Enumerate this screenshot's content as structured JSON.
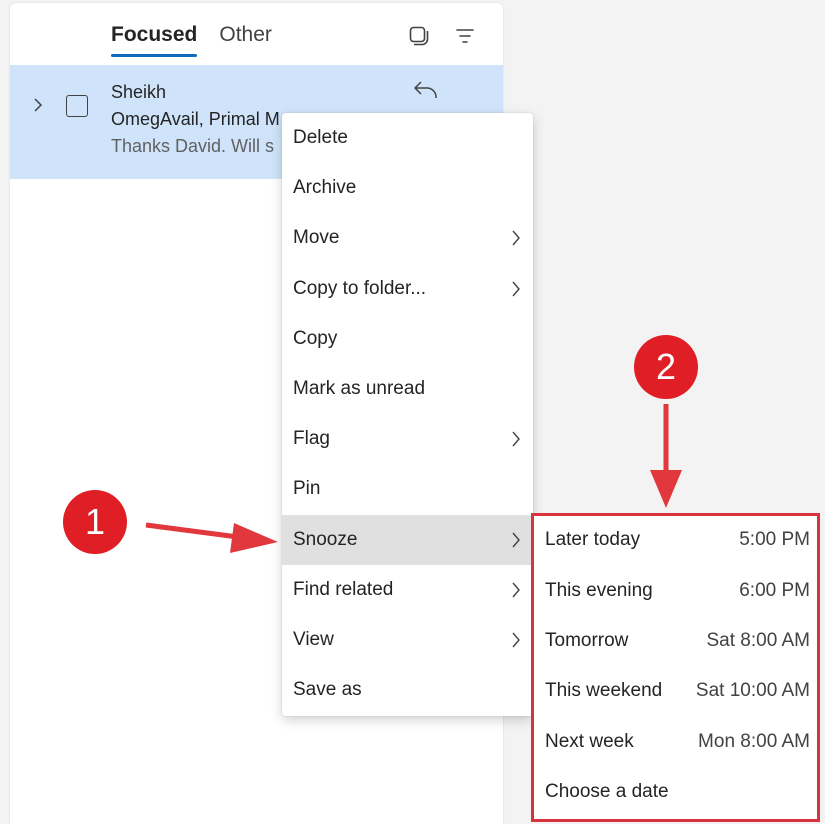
{
  "pivot": {
    "tabs": [
      {
        "label": "Focused",
        "active": true
      },
      {
        "label": "Other",
        "active": false
      }
    ]
  },
  "icons": {
    "select_mode": "select-mode-icon",
    "filter": "filter-icon",
    "expand": "chevron-right-icon",
    "reply": "reply-icon",
    "submenu": "chevron-right-icon"
  },
  "message": {
    "sender": "Sheikh",
    "subject": "OmegAvail, Primal M",
    "preview": "Thanks David. Will s"
  },
  "context_menu": {
    "items": [
      {
        "label": "Delete",
        "has_submenu": false
      },
      {
        "label": "Archive",
        "has_submenu": false
      },
      {
        "label": "Move",
        "has_submenu": true
      },
      {
        "label": "Copy to folder...",
        "has_submenu": true
      },
      {
        "label": "Copy",
        "has_submenu": false
      },
      {
        "label": "Mark as unread",
        "has_submenu": false
      },
      {
        "label": "Flag",
        "has_submenu": true
      },
      {
        "label": "Pin",
        "has_submenu": false
      },
      {
        "label": "Snooze",
        "has_submenu": true,
        "highlighted": true
      },
      {
        "label": "Find related",
        "has_submenu": true
      },
      {
        "label": "View",
        "has_submenu": true
      },
      {
        "label": "Save as",
        "has_submenu": false
      }
    ]
  },
  "snooze_menu": {
    "items": [
      {
        "label": "Later today",
        "time": "5:00 PM"
      },
      {
        "label": "This evening",
        "time": "6:00 PM"
      },
      {
        "label": "Tomorrow",
        "time": "Sat 8:00 AM"
      },
      {
        "label": "This weekend",
        "time": "Sat 10:00 AM"
      },
      {
        "label": "Next week",
        "time": "Mon 8:00 AM"
      },
      {
        "label": "Choose a date",
        "time": ""
      }
    ]
  },
  "annotations": {
    "step1": "1",
    "step2": "2"
  },
  "colors": {
    "accent": "#0f6cbd",
    "selected_row": "#cfe4fa",
    "menu_hover": "#e0e0e0",
    "annotation_red": "#e01e26",
    "highlight_frame": "#d9343d"
  }
}
